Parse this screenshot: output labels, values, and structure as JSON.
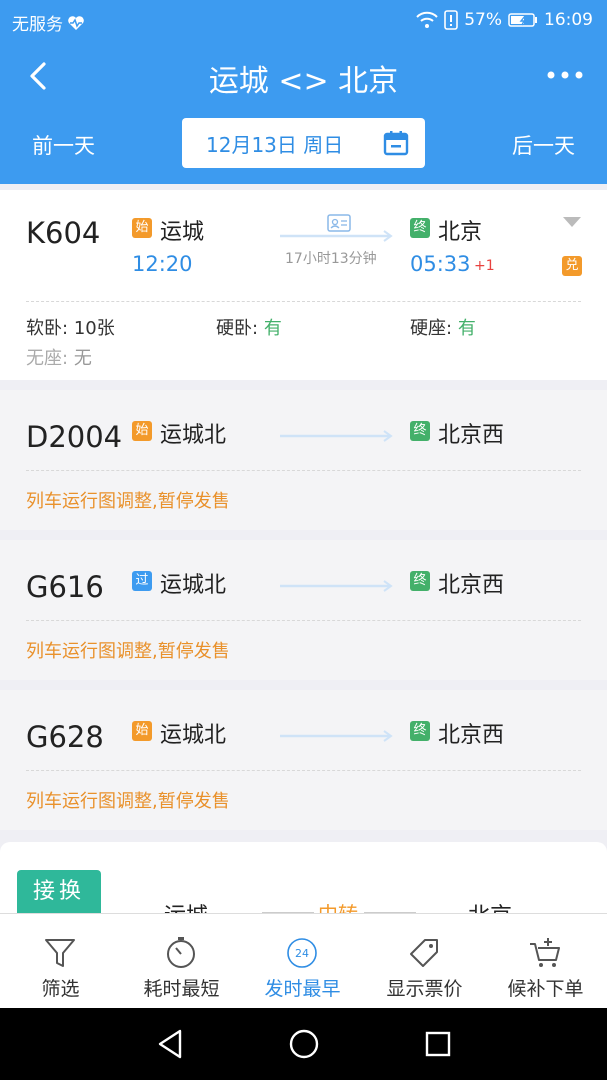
{
  "status_bar": {
    "carrier": "无服务",
    "battery": "57%",
    "time": "16:09"
  },
  "header": {
    "title": "运城 <> 北京",
    "prev_day": "前一天",
    "next_day": "后一天",
    "date": "12月13日 周日"
  },
  "trains": [
    {
      "number": "K604",
      "from_badge": "始",
      "from": "运城",
      "depart": "12:20",
      "to_badge": "终",
      "to": "北京",
      "arrive": "05:33",
      "arrive_offset": "+1",
      "duration": "17小时13分钟",
      "exchange_badge": "兑",
      "seats": [
        {
          "name": "软卧:",
          "value": "10张"
        },
        {
          "name": "硬卧:",
          "value": "有"
        },
        {
          "name": "硬座:",
          "value": "有"
        },
        {
          "name": "无座:",
          "value": "无"
        }
      ]
    },
    {
      "number": "D2004",
      "from_badge": "始",
      "from": "运城北",
      "to_badge": "终",
      "to": "北京西",
      "notice": "列车运行图调整,暂停发售"
    },
    {
      "number": "G616",
      "from_badge": "过",
      "from": "运城北",
      "to_badge": "终",
      "to": "北京西",
      "notice": "列车运行图调整,暂停发售"
    },
    {
      "number": "G628",
      "from_badge": "始",
      "from": "运城北",
      "to_badge": "终",
      "to": "北京西",
      "notice": "列车运行图调整,暂停发售"
    }
  ],
  "transfer": {
    "badge": "接换",
    "from": "运城",
    "mid": "中转",
    "to": "北京"
  },
  "tabs": [
    {
      "label": "筛选",
      "icon": "filter-icon"
    },
    {
      "label": "耗时最短",
      "icon": "timer-icon"
    },
    {
      "label": "发时最早",
      "icon": "clock-24-icon",
      "icon_text": "24"
    },
    {
      "label": "显示票价",
      "icon": "price-tag-icon"
    },
    {
      "label": "候补下单",
      "icon": "cart-add-icon"
    }
  ],
  "colors": {
    "primary": "#3d9bf0",
    "start_badge": "#f39a2b",
    "end_badge": "#43b06a",
    "notice": "#e9912b",
    "transfer_badge": "#2fb89a"
  }
}
